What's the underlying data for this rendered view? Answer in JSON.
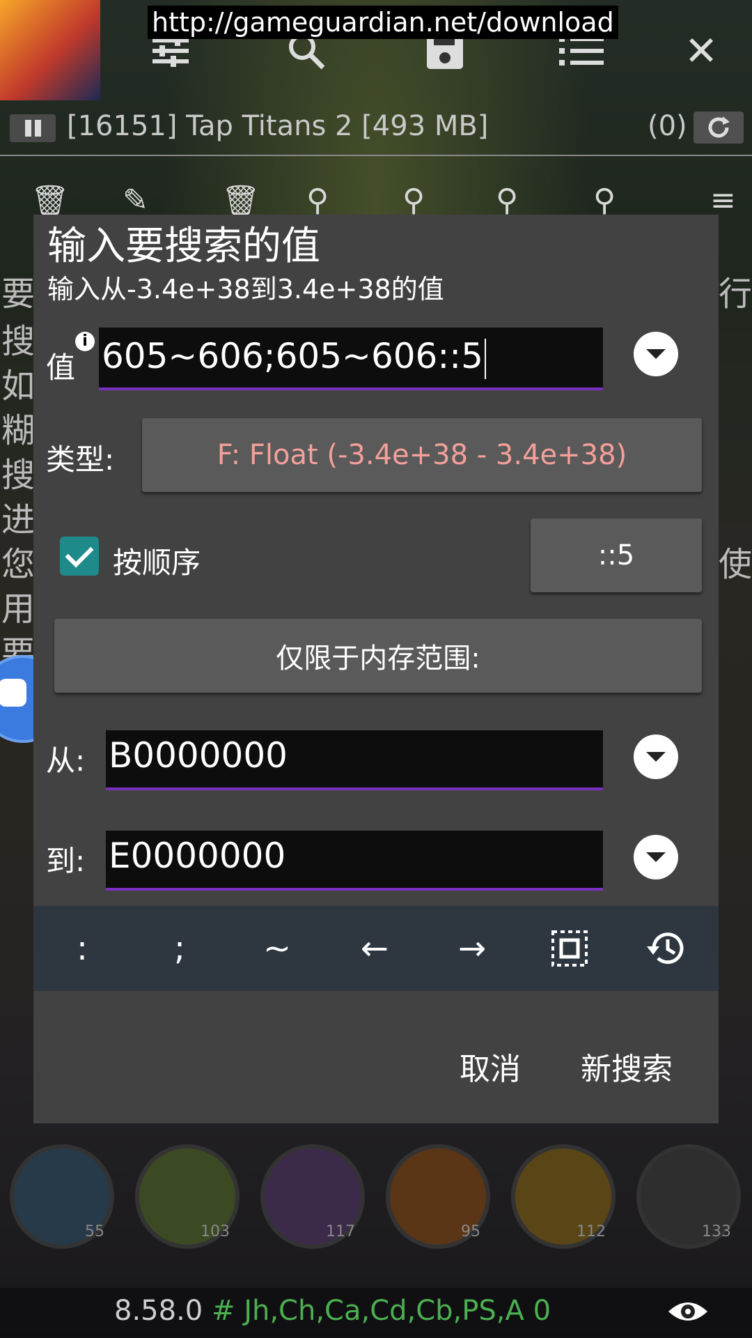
{
  "topbar": {
    "url": "http://gameguardian.net/download",
    "close_glyph": "✕",
    "icons": [
      "sliders-icon",
      "search-icon",
      "save-icon",
      "list-icon",
      "close-icon"
    ]
  },
  "process": {
    "label": "[16151] Tap Titans 2 [493 MB]",
    "count": "(0)"
  },
  "side_chars": [
    "要",
    "搜",
    "如",
    "糊",
    "搜",
    "进",
    "您",
    "用",
    "要",
    "行",
    "使"
  ],
  "dialog": {
    "title": "输入要搜索的值",
    "subtitle": "输入从-3.4e+38到3.4e+38的值",
    "value_label": "值",
    "value_input": "605~606;605~606::5",
    "type_label": "类型:",
    "type_value": "F: Float (-3.4e+38 - 3.4e+38)",
    "ordered_label": "按顺序",
    "ordered_checked": true,
    "range_button": "::5",
    "memory_range_button": "仅限于内存范围:",
    "from_label": "从:",
    "from_value": "B0000000",
    "to_label": "到:",
    "to_value": "E0000000",
    "keys": [
      ":",
      ";",
      "~",
      "←",
      "→"
    ],
    "cancel": "取消",
    "new_search": "新搜索"
  },
  "bottom": {
    "levels": [
      "55",
      "103",
      "117",
      "95",
      "112",
      "133"
    ],
    "version": "8.58.0",
    "hash": "#",
    "regions": "Jh,Ch,Ca,Cd,Cb,PS,A 0"
  },
  "colors": {
    "accent_purple": "#7b2fbf",
    "checkbox_teal": "#1e8a8a",
    "type_value_color": "#f4a09a"
  }
}
